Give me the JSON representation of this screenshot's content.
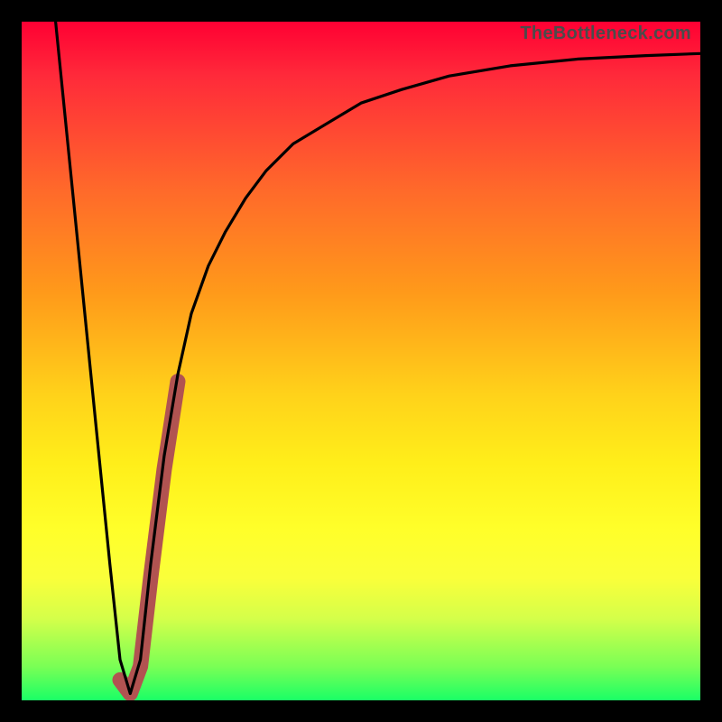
{
  "watermark": "TheBottleneck.com",
  "colors": {
    "frame": "#000000",
    "curve": "#000000",
    "highlight_segment": "#b15351",
    "gradient_top": "#ff0033",
    "gradient_bottom": "#1aff66"
  },
  "chart_data": {
    "type": "line",
    "title": "",
    "xlabel": "",
    "ylabel": "",
    "xlim": [
      0,
      100
    ],
    "ylim": [
      0,
      100
    ],
    "grid": false,
    "legend": false,
    "note": "No axis ticks or numeric labels are visible in the image; x/y units are normalized to the plot box.",
    "series": [
      {
        "name": "curve",
        "color": "#000000",
        "x": [
          5,
          8,
          11,
          13,
          14.5,
          16,
          17.5,
          19,
          21,
          23,
          25,
          27.5,
          30,
          33,
          36,
          40,
          45,
          50,
          56,
          63,
          72,
          82,
          92,
          100
        ],
        "y": [
          100,
          70,
          40,
          20,
          6,
          1,
          6,
          20,
          36,
          48,
          57,
          64,
          69,
          74,
          78,
          82,
          85,
          88,
          90,
          92,
          93.5,
          94.5,
          95,
          95.3
        ]
      },
      {
        "name": "highlight-segment",
        "color": "#b15351",
        "x": [
          14.5,
          16,
          17.5,
          19,
          21,
          23
        ],
        "y": [
          3,
          1,
          5,
          18,
          34,
          47
        ]
      }
    ]
  }
}
